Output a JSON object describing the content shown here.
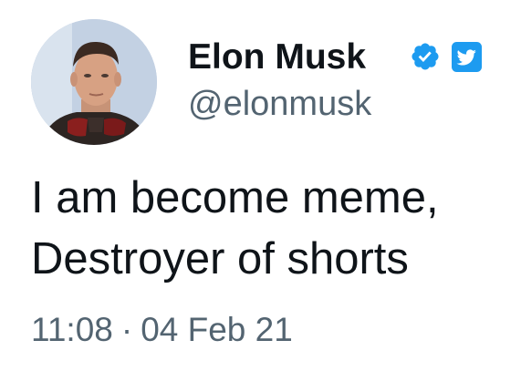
{
  "author": {
    "display_name": "Elon Musk",
    "handle": "@elonmusk",
    "avatar_icon": "profile-photo",
    "verified_icon": "verified-badge-icon",
    "platform_icon": "twitter-logo-icon"
  },
  "tweet": {
    "lines": [
      "I am become meme,",
      "Destroyer of shorts"
    ]
  },
  "meta": {
    "time": "11:08",
    "separator": "·",
    "date": "04 Feb 21"
  },
  "colors": {
    "text_primary": "#0f1419",
    "text_secondary": "#536471",
    "brand_blue": "#1d9bf0",
    "background": "#ffffff"
  }
}
